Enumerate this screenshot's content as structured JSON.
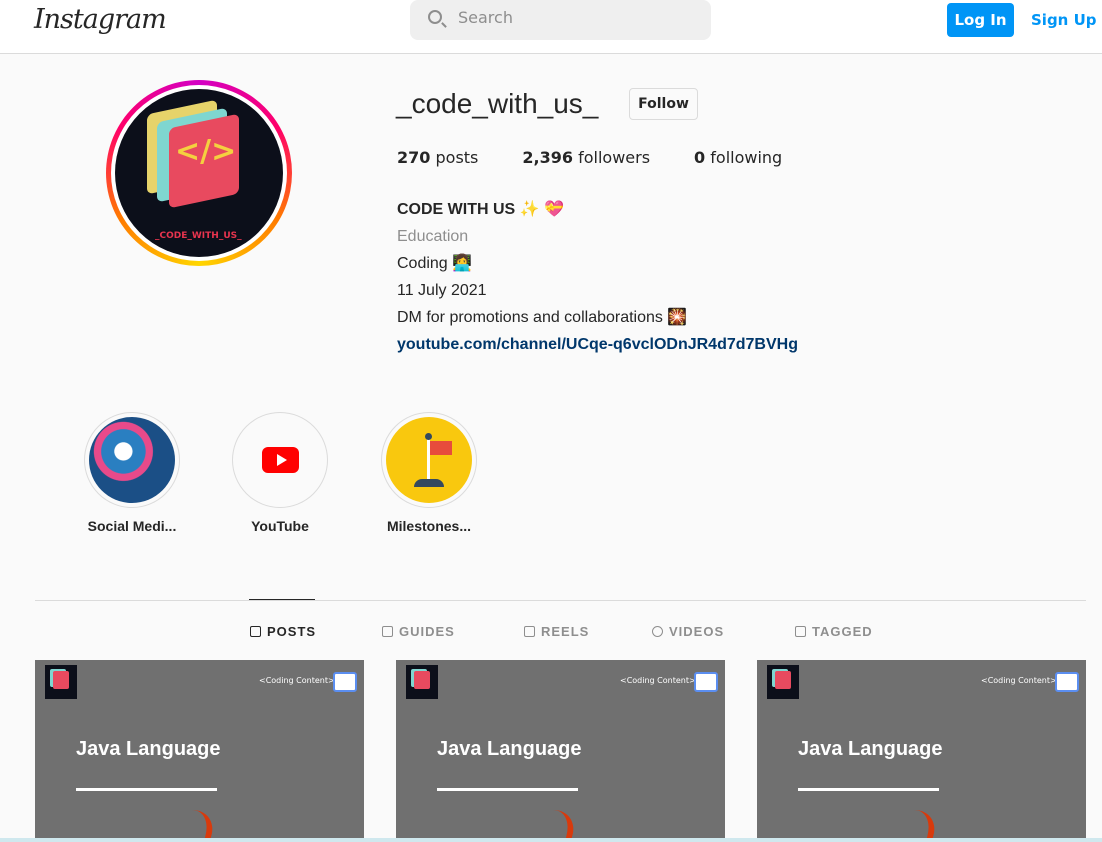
{
  "header": {
    "logo": "Instagram",
    "search_placeholder": "Search",
    "login_label": "Log In",
    "signup_label": "Sign Up"
  },
  "profile": {
    "username": "_code_with_us_",
    "follow_label": "Follow",
    "avatar_text": "_CODE_WITH_US_",
    "avatar_code": "</>",
    "stats": [
      {
        "num": "270",
        "label": "posts"
      },
      {
        "num": "2,396",
        "label": "followers"
      },
      {
        "num": "0",
        "label": "following"
      }
    ],
    "bio": {
      "title": "CODE WITH US ✨ 💝",
      "category": "Education",
      "line1": "Coding 👩‍💻",
      "line2": "11 July 2021",
      "line3": "DM for promotions and collaborations 🎇",
      "link": "youtube.com/channel/UCqe-q6vclODnJR4d7d7BVHg"
    }
  },
  "highlights": [
    {
      "label": "Social Medi..."
    },
    {
      "label": "YouTube"
    },
    {
      "label": "Milestones..."
    }
  ],
  "tabs": [
    {
      "label": "POSTS"
    },
    {
      "label": "GUIDES"
    },
    {
      "label": "REELS"
    },
    {
      "label": "VIDEOS"
    },
    {
      "label": "TAGGED"
    }
  ],
  "posts": [
    {
      "tag": "<Coding Content>",
      "title": "Java Language"
    },
    {
      "tag": "<Coding Content>",
      "title": "Java Language"
    },
    {
      "tag": "<Coding Content>",
      "title": "Java Language"
    }
  ],
  "colors": {
    "accent": "#0095f6",
    "link": "#00376b"
  }
}
